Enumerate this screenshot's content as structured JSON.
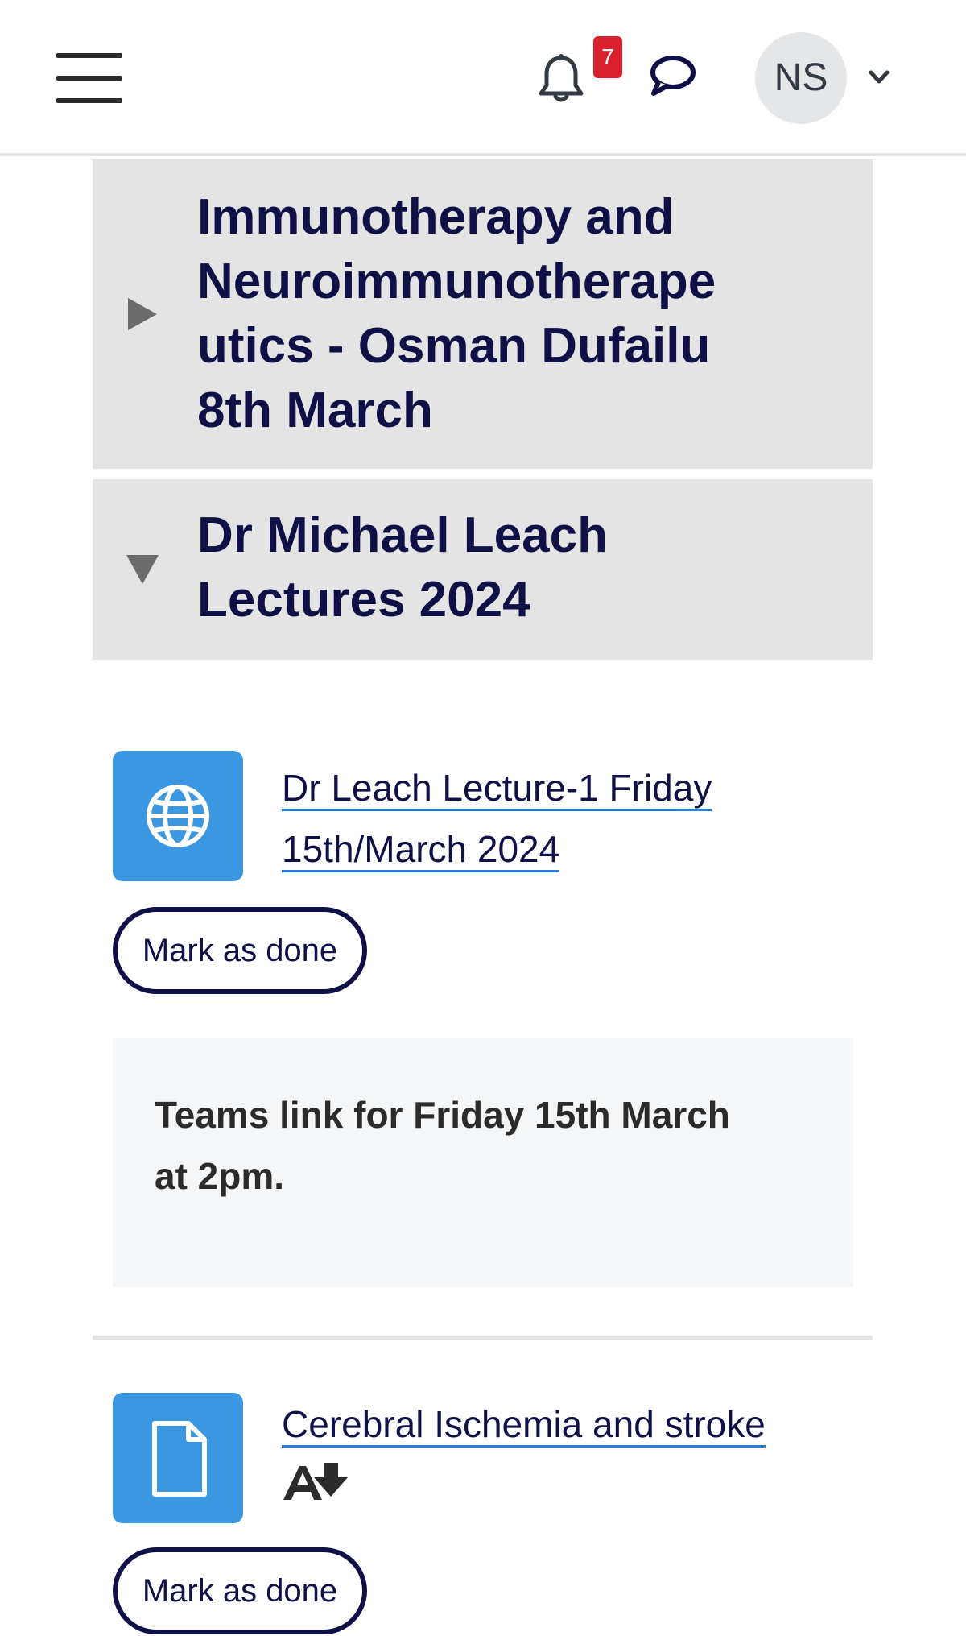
{
  "header": {
    "menu_icon": "hamburger-menu-icon",
    "notification_icon": "bell-icon",
    "notification_count": "7",
    "message_icon": "chat-bubble-icon",
    "user_initials": "NS",
    "user_menu_icon": "chevron-down-icon"
  },
  "sections": [
    {
      "title": "Immunotherapy and Neuroimmunotherapeutics - Osman Dufailu 8th March",
      "title_lines": [
        "Immunotherapy and",
        "Neuroimmunotherape",
        "utics - Osman Dufailu",
        "8th March"
      ],
      "expanded": false
    },
    {
      "title": "Dr Michael Leach Lectures 2024",
      "title_lines": [
        "Dr Michael Leach",
        "Lectures 2024"
      ],
      "expanded": true
    }
  ],
  "activities": [
    {
      "icon": "globe-icon",
      "title": "Dr Leach Lecture-1 Friday 15th/March 2024",
      "title_lines": [
        "Dr Leach Lecture-1 Friday",
        "15th/March 2024"
      ],
      "button_label": "Mark as done",
      "description": "Teams link for Friday 15th March at 2pm.",
      "description_lines": [
        "Teams link for Friday 15th March",
        "at 2pm."
      ]
    },
    {
      "icon": "file-icon",
      "title": "Cerebral Ischemia and stroke",
      "extra_icon": "accessibility-download-icon",
      "button_label": "Mark as done"
    }
  ],
  "colors": {
    "brand_navy": "#0f1046",
    "activity_icon_bg": "#3b98e0",
    "badge_red": "#d9202f",
    "section_bg": "#e4e4e5",
    "link_underline": "#2a7bd8"
  }
}
